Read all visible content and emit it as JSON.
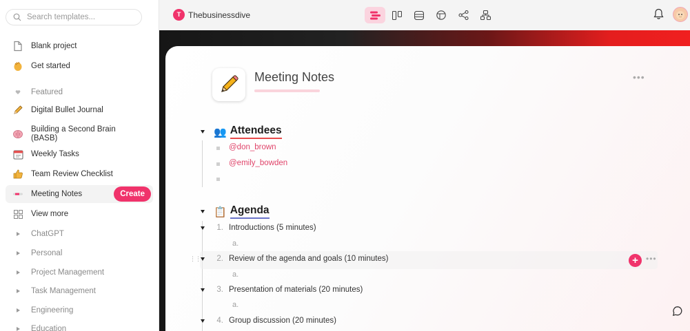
{
  "search": {
    "placeholder": "Search templates..."
  },
  "sidebar": {
    "items": [
      {
        "label": "Blank project"
      },
      {
        "label": "Get started"
      },
      {
        "label": "Featured"
      },
      {
        "label": "Digital Bullet Journal"
      },
      {
        "label": "Building a Second Brain (BASB)"
      },
      {
        "label": "Weekly Tasks"
      },
      {
        "label": "Team Review Checklist"
      },
      {
        "label": "Meeting Notes"
      },
      {
        "label": "View more"
      },
      {
        "label": "ChatGPT"
      },
      {
        "label": "Personal"
      },
      {
        "label": "Project Management"
      },
      {
        "label": "Task Management"
      },
      {
        "label": "Engineering"
      },
      {
        "label": "Education"
      }
    ],
    "create_label": "Create"
  },
  "topbar": {
    "workspace_initial": "T",
    "workspace_name": "Thebusinessdive",
    "views": [
      "document-view-icon",
      "board-view-icon",
      "table-view-icon",
      "layout-view-icon",
      "mindmap-view-icon",
      "org-chart-view-icon"
    ],
    "active_view": 0
  },
  "doc": {
    "title": "Meeting Notes",
    "attendees": {
      "heading": "Attendees",
      "emoji": "👥",
      "people": [
        "@don_brown",
        "@emily_bowden"
      ]
    },
    "agenda": {
      "heading": "Agenda",
      "emoji": "📋",
      "items": [
        {
          "num": "1.",
          "text": "Introductions (5 minutes)",
          "sub": "a."
        },
        {
          "num": "2.",
          "text": "Review of the agenda and goals (10 minutes)",
          "sub": "a."
        },
        {
          "num": "3.",
          "text": "Presentation of materials (20 minutes)",
          "sub": "a."
        },
        {
          "num": "4.",
          "text": "Group discussion (20 minutes)"
        }
      ]
    }
  },
  "colors": {
    "accent": "#f0336b",
    "attendees_underline": "#e84a4a",
    "agenda_underline": "#6a73c9"
  }
}
